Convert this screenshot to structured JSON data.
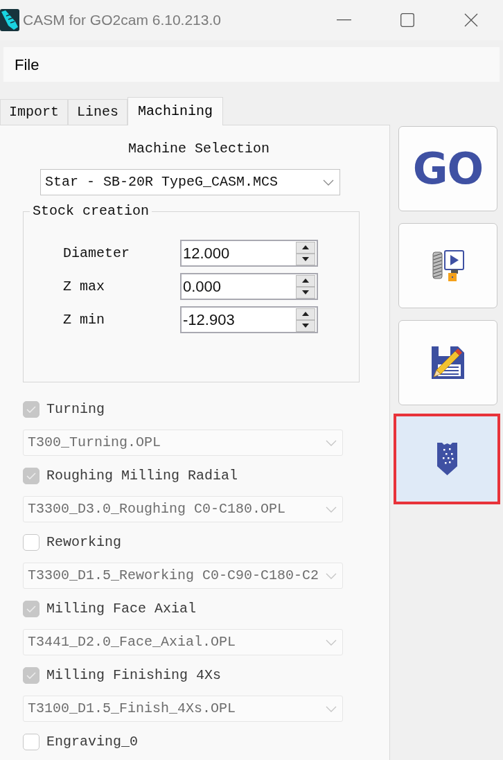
{
  "window": {
    "title": "CASM for GO2cam 6.10.213.0"
  },
  "menu": [
    {
      "label": "File"
    }
  ],
  "tabs": [
    {
      "label": "Import",
      "selected": false
    },
    {
      "label": "Lines",
      "selected": false
    },
    {
      "label": "Machining",
      "selected": true
    }
  ],
  "machine_selection": {
    "label": "Machine Selection",
    "value": "Star - SB-20R TypeG_CASM.MCS"
  },
  "stock_creation": {
    "title": "Stock creation",
    "fields": [
      {
        "label": "Diameter",
        "value": "12.000"
      },
      {
        "label": "Z max",
        "value": "0.000"
      },
      {
        "label": "Z min",
        "value": "-12.903"
      }
    ]
  },
  "operations": [
    {
      "label": "Turning",
      "checked": true,
      "disabled": true,
      "file": "T300_Turning.OPL"
    },
    {
      "label": "Roughing Milling Radial",
      "checked": true,
      "disabled": true,
      "file": "T3300_D3.0_Roughing C0-C180.OPL"
    },
    {
      "label": "Reworking",
      "checked": false,
      "disabled": true,
      "file": "T3300_D1.5_Reworking C0-C90-C180-C2"
    },
    {
      "label": "Milling Face Axial",
      "checked": true,
      "disabled": true,
      "file": "T3441_D2.0_Face_Axial.OPL"
    },
    {
      "label": "Milling Finishing 4Xs",
      "checked": true,
      "disabled": true,
      "file": "T3100_D1.5_Finish_4Xs.OPL"
    },
    {
      "label": "Engraving_0",
      "checked": false,
      "disabled": true
    }
  ],
  "tool_buttons": [
    {
      "kind": "go",
      "label": "GO",
      "selected": false
    },
    {
      "kind": "simulate",
      "selected": false
    },
    {
      "kind": "save",
      "selected": false
    },
    {
      "kind": "insert",
      "selected": true
    }
  ]
}
